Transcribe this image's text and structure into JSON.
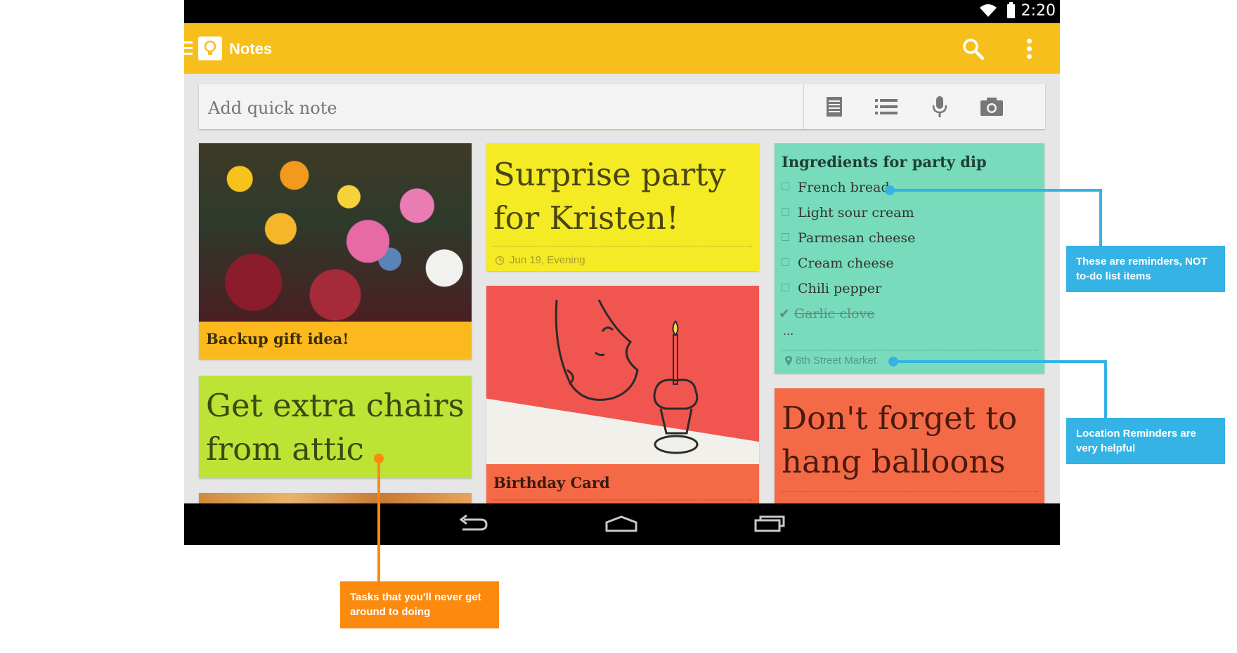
{
  "status_bar": {
    "time": "2:20",
    "icons": [
      "wifi-icon",
      "battery-icon"
    ]
  },
  "app_bar": {
    "title": "Notes",
    "icons": [
      "menu-icon",
      "keep-logo-icon",
      "search-icon",
      "overflow-menu-icon"
    ],
    "color": "#f7bf1c"
  },
  "quick_note": {
    "placeholder": "Add quick note",
    "tools": [
      "text-note-icon",
      "list-note-icon",
      "microphone-icon",
      "camera-icon"
    ]
  },
  "notes": {
    "photo_note": {
      "title": "Backup gift idea!",
      "color": "#fcb91e"
    },
    "chairs_note": {
      "text_line1": "Get extra chairs",
      "text_line2": "from attic",
      "color": "#bde335"
    },
    "party_note": {
      "text_line1": "Surprise party",
      "text_line2": "for Kristen!",
      "reminder": "Jun 19, Evening",
      "color": "#f4eb25"
    },
    "birthday_note": {
      "title": "Birthday Card",
      "color": "#f46a46"
    },
    "dip_note": {
      "title": "Ingredients for party dip",
      "items": [
        {
          "label": "French bread",
          "checked": false
        },
        {
          "label": "Light  sour cream",
          "checked": false
        },
        {
          "label": "Parmesan cheese",
          "checked": false
        },
        {
          "label": "Cream cheese",
          "checked": false
        },
        {
          "label": "Chili pepper",
          "checked": false
        },
        {
          "label": "Garlic clove",
          "checked": true
        }
      ],
      "more": "...",
      "location": "8th Street Market",
      "color": "#78dbbb"
    },
    "balloons_note": {
      "text_line1": "Don't forget to",
      "text_line2": "hang balloons",
      "color": "#f46a46"
    }
  },
  "nav_bar": {
    "icons": [
      "back-icon",
      "home-icon",
      "recents-icon"
    ]
  },
  "callouts": {
    "reminders": "These are reminders, NOT to-do list items",
    "location": "Location Reminders are very helpful",
    "tasks": "Tasks that you'll never get around to doing",
    "blue": "#35b3e5",
    "orange": "#fb8a0e"
  }
}
